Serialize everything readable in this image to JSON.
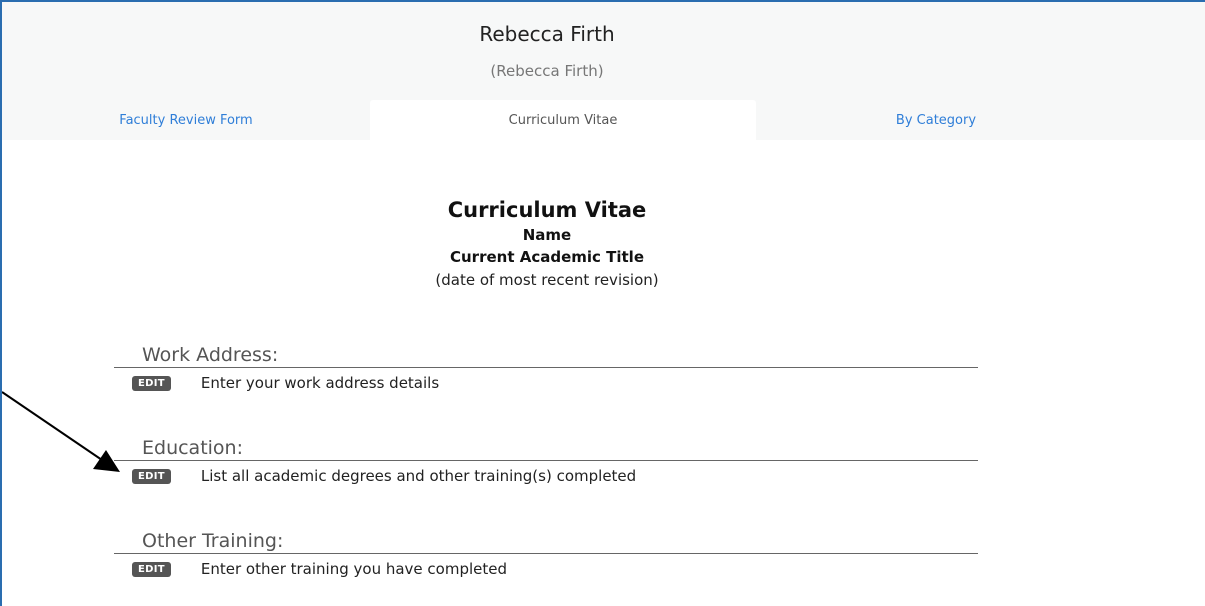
{
  "header": {
    "user_name": "Rebecca Firth",
    "user_sub": "(Rebecca Firth)"
  },
  "tabs": [
    {
      "label": "Faculty Review Form",
      "active": false
    },
    {
      "label": "Curriculum Vitae",
      "active": true
    },
    {
      "label": "By Category",
      "active": false
    }
  ],
  "cv": {
    "title": "Curriculum Vitae",
    "name_line": "Name",
    "title_line": "Current Academic Title",
    "date_line": "(date of most recent revision)"
  },
  "sections": [
    {
      "title": "Work Address:",
      "button": "EDIT",
      "description": "Enter your work address details"
    },
    {
      "title": "Education:",
      "button": "EDIT",
      "description": "List all academic degrees and other training(s) completed"
    },
    {
      "title": "Other Training:",
      "button": "EDIT",
      "description": "Enter other training you have completed"
    }
  ],
  "colors": {
    "accent": "#2f7ed8",
    "frame": "#2a6db0",
    "edit_bg": "#555555"
  }
}
